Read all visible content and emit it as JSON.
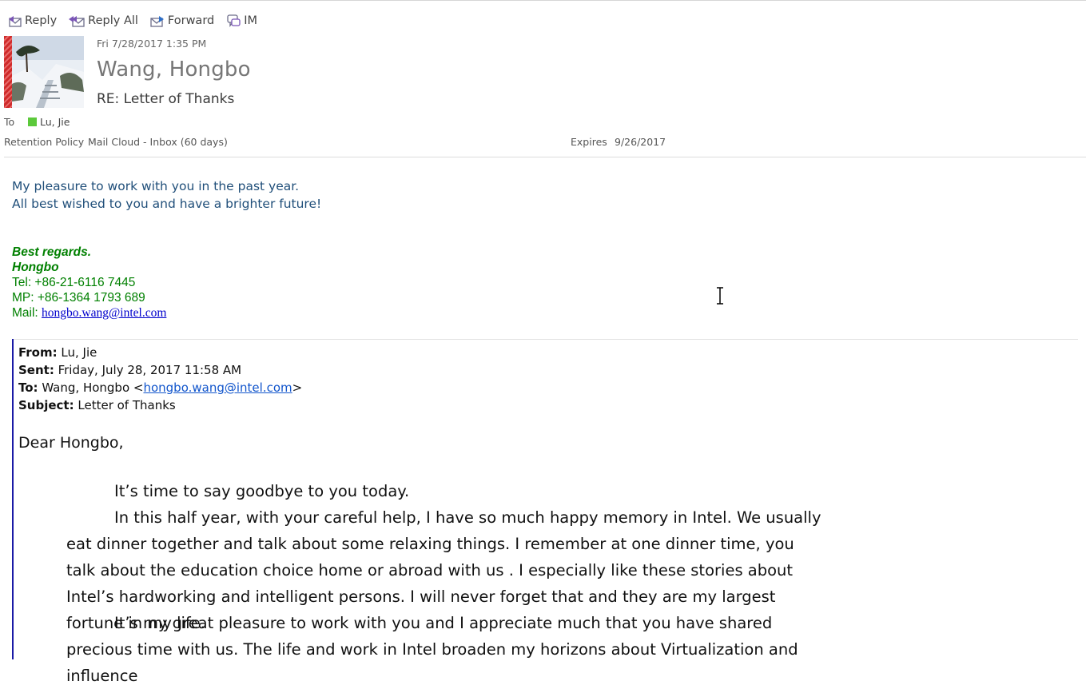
{
  "toolbar": {
    "reply": "Reply",
    "reply_all": "Reply All",
    "forward": "Forward",
    "im": "IM"
  },
  "header": {
    "datetime": "Fri 7/28/2017 1:35 PM",
    "sender": "Wang, Hongbo",
    "subject": "RE: Letter of Thanks",
    "to_label": "To",
    "recipient": "Lu, Jie",
    "retention_label": "Retention Policy",
    "retention_value": "Mail Cloud - Inbox (60 days)",
    "expires_label": "Expires",
    "expires_value": "9/26/2017"
  },
  "reply_body": {
    "line1": "My pleasure to work with you in the past year.",
    "line2": "All best wished to you and have a brighter future!"
  },
  "signature": {
    "regards": "Best regards.",
    "name": "Hongbo",
    "tel": "Tel: +86-21-6116 7445",
    "mp": "MP: +86-1364 1793 689",
    "mail_label": "Mail: ",
    "mail_link": "hongbo.wang@intel.com"
  },
  "quoted": {
    "from_label": "From:",
    "from_value": " Lu, Jie",
    "sent_label": "Sent:",
    "sent_value": " Friday, July 28, 2017 11:58 AM",
    "to_label": "To:",
    "to_value": " Wang, Hongbo <",
    "to_email": "hongbo.wang@intel.com",
    "to_suffix": ">",
    "subject_label": "Subject:",
    "subject_value": " Letter of Thanks",
    "greeting": "Dear Hongbo,",
    "para1": "It’s time to say goodbye to you today.",
    "para2": "In this half year, with your careful help, I have so much happy memory in Intel. We usually eat dinner together and talk about some relaxing things. I remember at one dinner time, you talk about the education choice home or abroad with us . I especially like these stories about Intel’s hardworking and intelligent persons. I will never forget that and they are my largest fortune in my life.",
    "para3": "It’s my great pleasure to work with you and I appreciate much that you have shared precious time with us. The life and work in Intel broaden my horizons about Virtualization and influence"
  },
  "colors": {
    "reply_text": "#1f4e79",
    "signature": "#008000",
    "quote_bar": "#1a1aa6",
    "presence": "#5cc93b"
  }
}
